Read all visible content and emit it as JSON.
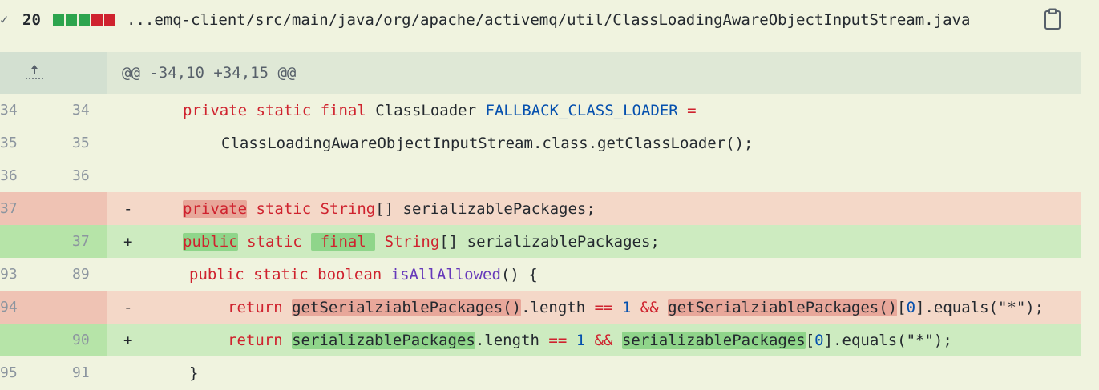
{
  "file": {
    "collapse_glyph": "✓",
    "changes": "20",
    "bars": [
      "#2da44e",
      "#2da44e",
      "#2da44e",
      "#cf222e",
      "#cf222e"
    ],
    "path": "...emq-client/src/main/java/org/apache/activemq/util/ClassLoadingAwareObjectInputStream.java",
    "copy_icon": "clipboard-icon"
  },
  "hunk": {
    "header": "@@ -34,10 +34,15 @@",
    "expand_icon": "expand-up-icon"
  },
  "lines": [
    {
      "type": "ctx",
      "old": "34",
      "new": "34",
      "marker": "",
      "tokens": [
        {
          "t": "private static final ",
          "c": "kw"
        },
        {
          "t": "ClassLoader ",
          "c": "typ"
        },
        {
          "t": "FALLBACK_CLASS_LOADER",
          "c": "const"
        },
        {
          "t": " =",
          "c": "kw"
        }
      ]
    },
    {
      "type": "ctx",
      "old": "35",
      "new": "35",
      "marker": "",
      "tokens": [
        {
          "t": "ClassLoadingAwareObjectInputStream",
          "c": "typ"
        },
        {
          "t": ".class.",
          "c": "typ"
        },
        {
          "t": "getClassLoader",
          "c": "typ"
        },
        {
          "t": "();",
          "c": "typ"
        }
      ]
    },
    {
      "type": "ctx",
      "old": "36",
      "new": "36",
      "marker": "",
      "tokens": []
    },
    {
      "type": "del",
      "old": "37",
      "new": "",
      "marker": "-",
      "tokens": [
        {
          "t": "private",
          "c": "kw",
          "h": 1
        },
        {
          "t": " static ",
          "c": "kw"
        },
        {
          "t": "String",
          "c": "kw"
        },
        {
          "t": "[] serializablePackages;",
          "c": "typ"
        }
      ]
    },
    {
      "type": "add",
      "old": "",
      "new": "37",
      "marker": "+",
      "tokens": [
        {
          "t": "public",
          "c": "kw",
          "h": 1
        },
        {
          "t": " static ",
          "c": "kw"
        },
        {
          "t": " final ",
          "c": "kw",
          "h": 1
        },
        {
          "t": " String",
          "c": "kw"
        },
        {
          "t": "[] serializablePackages;",
          "c": "typ"
        }
      ]
    },
    {
      "type": "ctx",
      "old": "93",
      "new": "89",
      "marker": "",
      "tokens": [
        {
          "t": "public static boolean ",
          "c": "kw"
        },
        {
          "t": "isAllAllowed",
          "c": "fn"
        },
        {
          "t": "() {",
          "c": "typ"
        }
      ]
    },
    {
      "type": "del",
      "old": "94",
      "new": "",
      "marker": "-",
      "tokens": [
        {
          "t": "return ",
          "c": "kw"
        },
        {
          "t": "getSerialziablePackages()",
          "c": "typ",
          "h": 1
        },
        {
          "t": ".length ",
          "c": "typ"
        },
        {
          "t": "==",
          "c": "kw"
        },
        {
          "t": " 1 ",
          "c": "num"
        },
        {
          "t": "&&",
          "c": "kw"
        },
        {
          "t": " ",
          "c": "typ"
        },
        {
          "t": "getSerialziablePackages()",
          "c": "typ",
          "h": 1
        },
        {
          "t": "[",
          "c": "typ"
        },
        {
          "t": "0",
          "c": "num"
        },
        {
          "t": "].equals(\"*\");",
          "c": "typ"
        }
      ]
    },
    {
      "type": "add",
      "old": "",
      "new": "90",
      "marker": "+",
      "tokens": [
        {
          "t": "return ",
          "c": "kw"
        },
        {
          "t": "serializablePackages",
          "c": "typ",
          "h": 1
        },
        {
          "t": ".length ",
          "c": "typ"
        },
        {
          "t": "==",
          "c": "kw"
        },
        {
          "t": " 1 ",
          "c": "num"
        },
        {
          "t": "&&",
          "c": "kw"
        },
        {
          "t": " ",
          "c": "typ"
        },
        {
          "t": "serializablePackages",
          "c": "typ",
          "h": 1
        },
        {
          "t": "[",
          "c": "typ"
        },
        {
          "t": "0",
          "c": "num"
        },
        {
          "t": "].equals(\"*\");",
          "c": "typ"
        }
      ]
    },
    {
      "type": "ctx",
      "old": "95",
      "new": "91",
      "marker": "",
      "tokens": [
        {
          "t": "}",
          "c": "typ"
        }
      ]
    }
  ]
}
